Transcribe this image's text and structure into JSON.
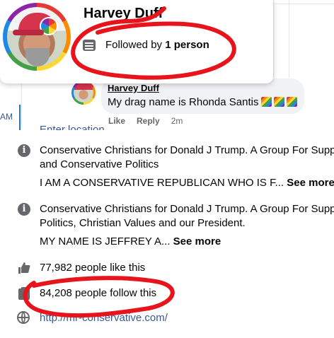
{
  "hover_card": {
    "name": "Harvey Duff",
    "followed_prefix": "Followed by ",
    "followed_count": "1 person"
  },
  "comment": {
    "author": "Harvey Duff",
    "text": "My drag name is Rhonda Santis",
    "actions": {
      "like": "Like",
      "reply": "Reply",
      "time": "2m"
    }
  },
  "sidebar": {
    "time_fragment": "AM"
  },
  "about": {
    "cutoff_label": "Enter location",
    "groups": [
      {
        "line1": "Conservative Christians for Donald J Trump. A Group For Supporters",
        "line2": "and Conservative Politics",
        "desc": "I AM A CONSERVATIVE REPUBLICAN WHO IS F...",
        "see_more": "See more"
      },
      {
        "line1": "Conservative Christians for Donald J Trump. A Group For Supporters",
        "line2": "Politics, Christian Values and our President.",
        "desc": "MY NAME IS JEFFREY A...",
        "see_more": "See more"
      }
    ],
    "likes": "77,982 people like this",
    "follows": "84,208 people follow this",
    "website": "http://mr-conservative.com/"
  },
  "icons": {
    "info": "info-icon",
    "like": "thumbs-up-icon",
    "follow": "follow-icon",
    "website": "globe-icon",
    "followed": "profile-card-icon"
  },
  "colors": {
    "accent": "#1877f2",
    "link": "#385898",
    "annotation": "#e8141c"
  }
}
